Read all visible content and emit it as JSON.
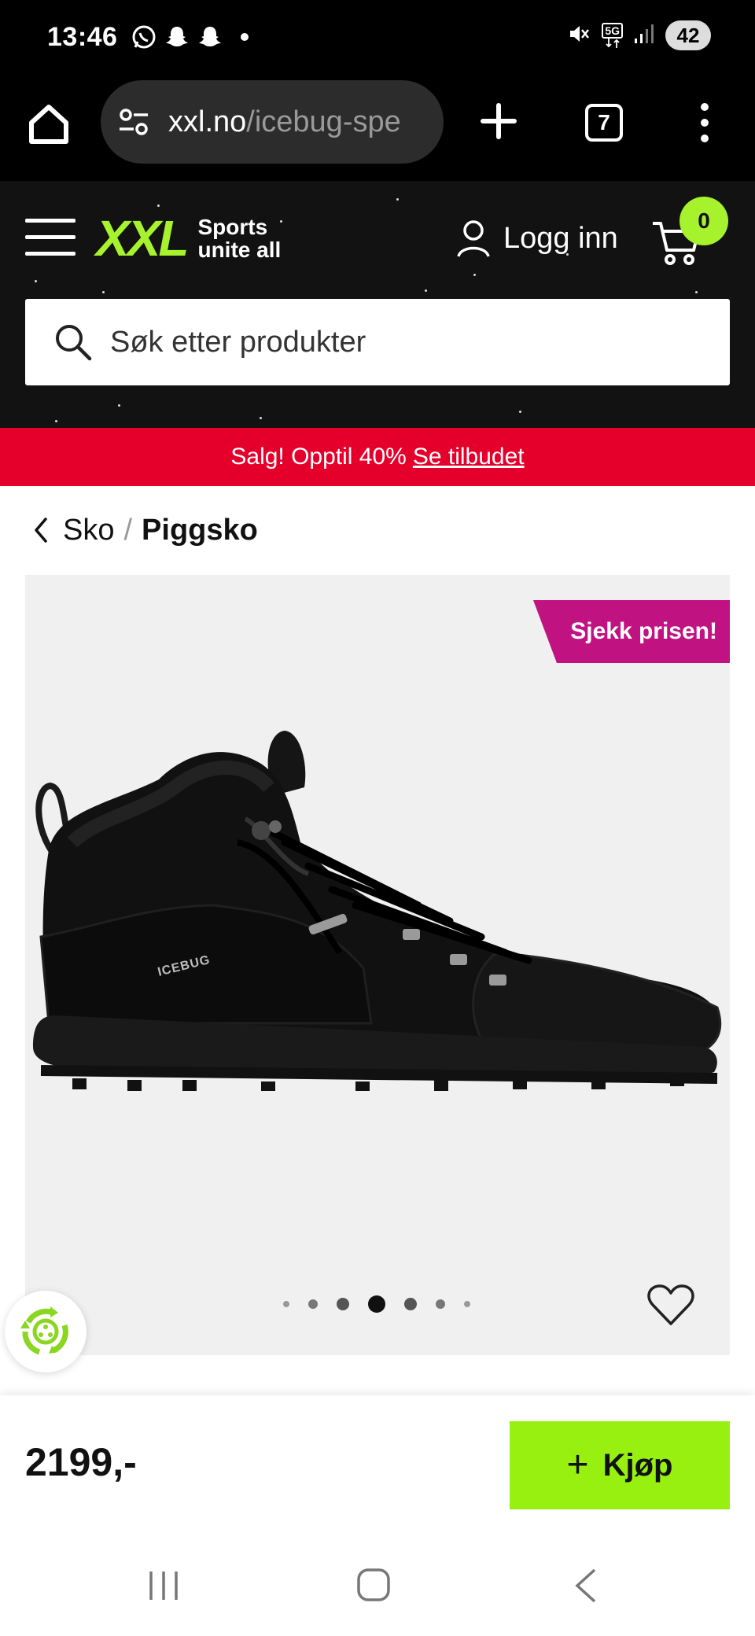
{
  "status_bar": {
    "time": "13:46",
    "left_icons": [
      "whatsapp-icon",
      "snapchat-icon",
      "snapchat-icon"
    ],
    "network": "5G",
    "battery": "42"
  },
  "browser": {
    "url_host": "xxl.no",
    "url_path": "/icebug-spe",
    "tab_count": "7"
  },
  "header": {
    "logo_text": "XXL",
    "logo_tagline_1": "Sports",
    "logo_tagline_2": "unite all",
    "login_label": "Logg inn",
    "cart_count": "0",
    "search_placeholder": "Søk etter produkter",
    "brand_color": "#a6f22c"
  },
  "promo": {
    "text": "Salg! Opptil 40%",
    "link": "Se tilbudet",
    "color": "#e4002b"
  },
  "breadcrumb": {
    "parent": "Sko",
    "separator": "/",
    "current": "Piggsko"
  },
  "product": {
    "ribbon": "Sjekk prisen!",
    "ribbon_color": "#c11282",
    "carousel_total": 7,
    "carousel_active": 4,
    "price": "2199,-",
    "buy_label": "Kjøp",
    "buy_color": "#97f00f"
  }
}
